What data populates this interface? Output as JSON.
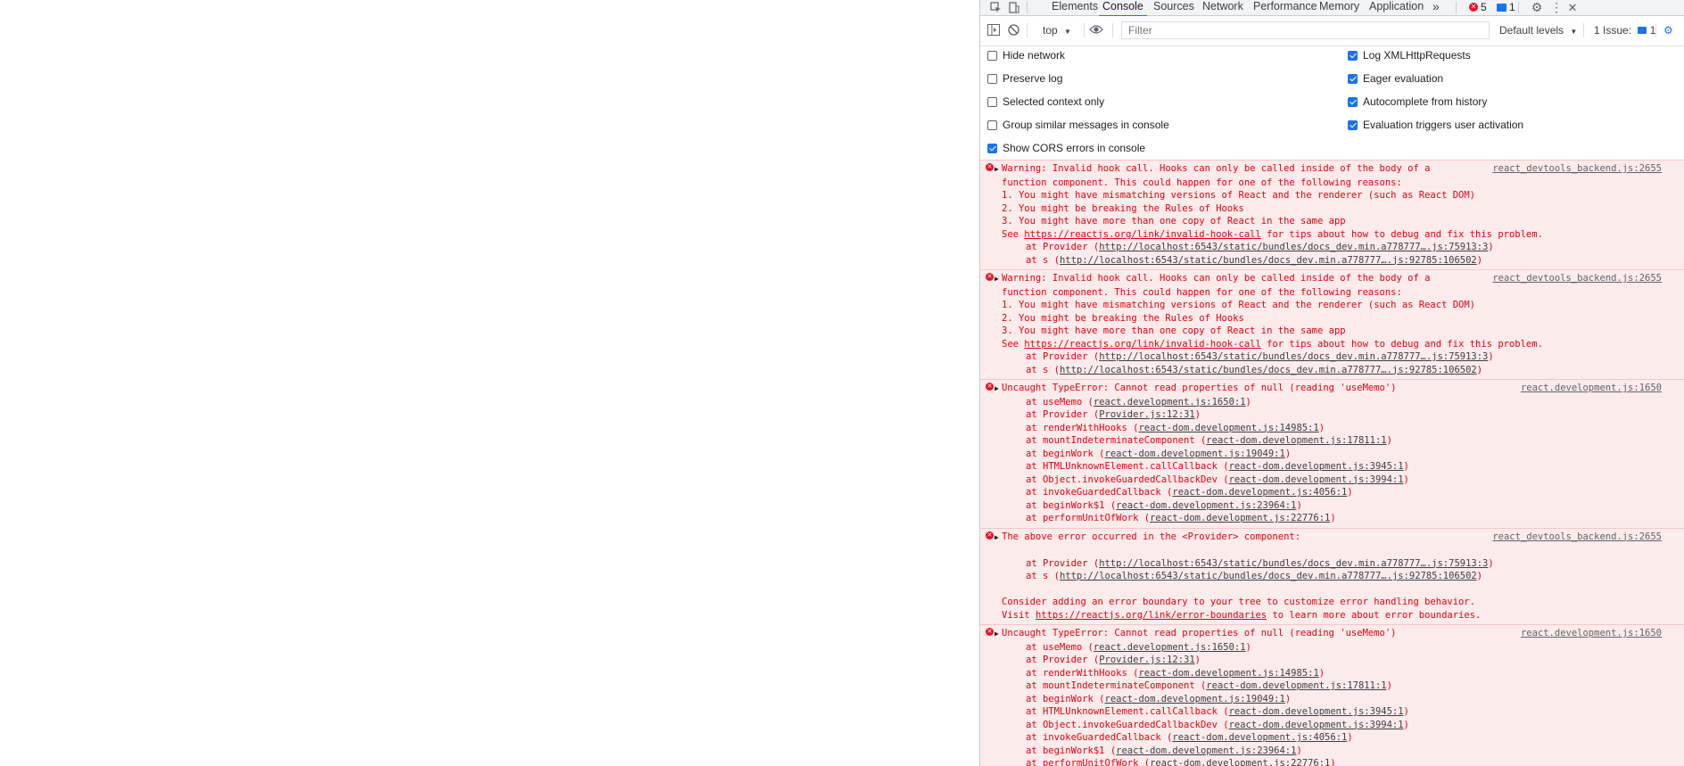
{
  "tabs": [
    "Elements",
    "Console",
    "Sources",
    "Network",
    "Performance",
    "Memory",
    "Application"
  ],
  "active_tab": "Console",
  "more_tabs": "»",
  "error_count": "5",
  "message_count": "1",
  "toolbar": {
    "context": "top",
    "filter_placeholder": "Filter",
    "levels": "Default levels",
    "issues": "1 Issue:",
    "issues_count": "1"
  },
  "settings": {
    "hide_network": "Hide network",
    "preserve_log": "Preserve log",
    "selected_context": "Selected context only",
    "group_similar": "Group similar messages in console",
    "show_cors": "Show CORS errors in console",
    "log_xhr": "Log XMLHttpRequests",
    "eager_eval": "Eager evaluation",
    "autocomplete": "Autocomplete from history",
    "eval_triggers": "Evaluation triggers user activation"
  },
  "messages": [
    {
      "source": "react_devtools_backend.js:2655",
      "lines": [
        "Warning: Invalid hook call. Hooks can only be called inside of the body of a",
        "function component. This could happen for one of the following reasons:",
        "1. You might have mismatching versions of React and the renderer (such as React DOM)",
        "2. You might be breaking the Rules of Hooks",
        "3. You might have more than one copy of React in the same app"
      ],
      "see_prefix": "See ",
      "see_link": "https://reactjs.org/link/invalid-hook-call",
      "see_suffix": " for tips about how to debug and fix this problem.",
      "stack": [
        {
          "prefix": "at Provider (",
          "link": "http://localhost:6543/static/bundles/docs_dev.min.a778777….js:75913:3",
          "suffix": ")"
        },
        {
          "prefix": "at s (",
          "link": "http://localhost:6543/static/bundles/docs_dev.min.a778777….js:92785:106502",
          "suffix": ")"
        }
      ]
    },
    {
      "source": "react_devtools_backend.js:2655",
      "lines": [
        "Warning: Invalid hook call. Hooks can only be called inside of the body of a",
        "function component. This could happen for one of the following reasons:",
        "1. You might have mismatching versions of React and the renderer (such as React DOM)",
        "2. You might be breaking the Rules of Hooks",
        "3. You might have more than one copy of React in the same app"
      ],
      "see_prefix": "See ",
      "see_link": "https://reactjs.org/link/invalid-hook-call",
      "see_suffix": " for tips about how to debug and fix this problem.",
      "stack": [
        {
          "prefix": "at Provider (",
          "link": "http://localhost:6543/static/bundles/docs_dev.min.a778777….js:75913:3",
          "suffix": ")"
        },
        {
          "prefix": "at s (",
          "link": "http://localhost:6543/static/bundles/docs_dev.min.a778777….js:92785:106502",
          "suffix": ")"
        }
      ]
    },
    {
      "source": "react.development.js:1650",
      "lines": [
        "Uncaught TypeError: Cannot read properties of null (reading 'useMemo')"
      ],
      "stack": [
        {
          "prefix": "at useMemo (",
          "link": "react.development.js:1650:1",
          "suffix": ")"
        },
        {
          "prefix": "at Provider (",
          "link": "Provider.js:12:31",
          "suffix": ")"
        },
        {
          "prefix": "at renderWithHooks (",
          "link": "react-dom.development.js:14985:1",
          "suffix": ")"
        },
        {
          "prefix": "at mountIndeterminateComponent (",
          "link": "react-dom.development.js:17811:1",
          "suffix": ")"
        },
        {
          "prefix": "at beginWork (",
          "link": "react-dom.development.js:19049:1",
          "suffix": ")"
        },
        {
          "prefix": "at HTMLUnknownElement.callCallback (",
          "link": "react-dom.development.js:3945:1",
          "suffix": ")"
        },
        {
          "prefix": "at Object.invokeGuardedCallbackDev (",
          "link": "react-dom.development.js:3994:1",
          "suffix": ")"
        },
        {
          "prefix": "at invokeGuardedCallback (",
          "link": "react-dom.development.js:4056:1",
          "suffix": ")"
        },
        {
          "prefix": "at beginWork$1 (",
          "link": "react-dom.development.js:23964:1",
          "suffix": ")"
        },
        {
          "prefix": "at performUnitOfWork (",
          "link": "react-dom.development.js:22776:1",
          "suffix": ")"
        }
      ]
    },
    {
      "source": "react_devtools_backend.js:2655",
      "lines": [
        "The above error occurred in the <Provider> component:"
      ],
      "pre_blank": true,
      "stack": [
        {
          "prefix": "at Provider (",
          "link": "http://localhost:6543/static/bundles/docs_dev.min.a778777….js:75913:3",
          "suffix": ")"
        },
        {
          "prefix": "at s (",
          "link": "http://localhost:6543/static/bundles/docs_dev.min.a778777….js:92785:106502",
          "suffix": ")"
        }
      ],
      "post_lines": [
        "Consider adding an error boundary to your tree to customize error handling behavior."
      ],
      "visit_prefix": "Visit ",
      "visit_link": "https://reactjs.org/link/error-boundaries",
      "visit_suffix": " to learn more about error boundaries."
    },
    {
      "source": "react.development.js:1650",
      "lines": [
        "Uncaught TypeError: Cannot read properties of null (reading 'useMemo')"
      ],
      "stack": [
        {
          "prefix": "at useMemo (",
          "link": "react.development.js:1650:1",
          "suffix": ")"
        },
        {
          "prefix": "at Provider (",
          "link": "Provider.js:12:31",
          "suffix": ")"
        },
        {
          "prefix": "at renderWithHooks (",
          "link": "react-dom.development.js:14985:1",
          "suffix": ")"
        },
        {
          "prefix": "at mountIndeterminateComponent (",
          "link": "react-dom.development.js:17811:1",
          "suffix": ")"
        },
        {
          "prefix": "at beginWork (",
          "link": "react-dom.development.js:19049:1",
          "suffix": ")"
        },
        {
          "prefix": "at HTMLUnknownElement.callCallback (",
          "link": "react-dom.development.js:3945:1",
          "suffix": ")"
        },
        {
          "prefix": "at Object.invokeGuardedCallbackDev (",
          "link": "react-dom.development.js:3994:1",
          "suffix": ")"
        },
        {
          "prefix": "at invokeGuardedCallback (",
          "link": "react-dom.development.js:4056:1",
          "suffix": ")"
        },
        {
          "prefix": "at beginWork$1 (",
          "link": "react-dom.development.js:23964:1",
          "suffix": ")"
        },
        {
          "prefix": "at performUnitOfWork (",
          "link": "react-dom.development.js:22776:1",
          "suffix": ")"
        }
      ]
    }
  ]
}
